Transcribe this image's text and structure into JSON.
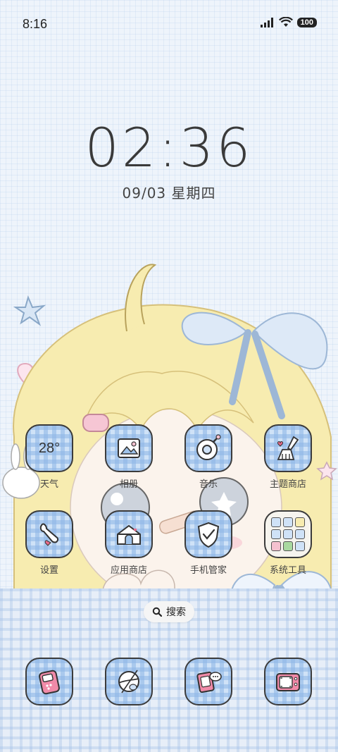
{
  "status_bar": {
    "time": "8:16",
    "battery": "100"
  },
  "clock": {
    "time": "02:36",
    "date": "09/03 星期四"
  },
  "weather": {
    "temp": "28°"
  },
  "apps_row1": [
    {
      "name": "天气",
      "icon": "weather-icon"
    },
    {
      "name": "相册",
      "icon": "gallery-icon"
    },
    {
      "name": "音乐",
      "icon": "music-icon"
    },
    {
      "name": "主题商店",
      "icon": "theme-store-icon"
    }
  ],
  "apps_row2": [
    {
      "name": "设置",
      "icon": "settings-icon"
    },
    {
      "name": "应用商店",
      "icon": "app-store-icon"
    },
    {
      "name": "手机管家",
      "icon": "security-icon"
    },
    {
      "name": "系统工具",
      "icon": "folder-icon"
    }
  ],
  "search": {
    "label": "搜索"
  },
  "dock": [
    {
      "icon": "phone-icon"
    },
    {
      "icon": "browser-icon"
    },
    {
      "icon": "messages-icon"
    },
    {
      "icon": "camera-icon"
    }
  ],
  "colors": {
    "tile": "#cfe2f7",
    "outline": "#3b3b3b",
    "hair": "#f7e9a8",
    "bow": "#dde9f7",
    "pink": "#f5c1cf"
  }
}
